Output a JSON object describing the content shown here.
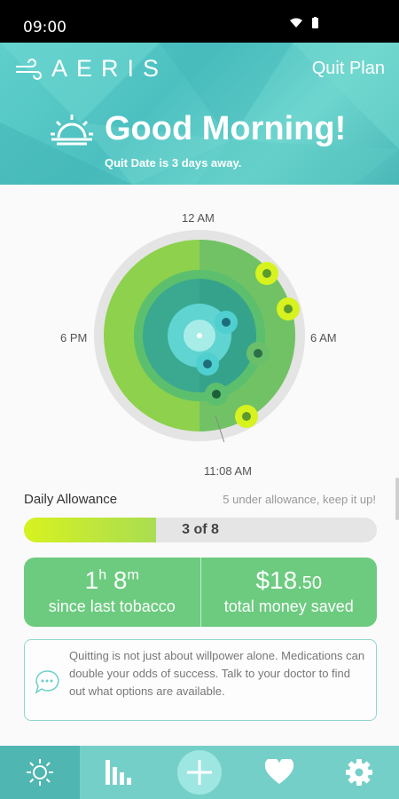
{
  "status_bar": {
    "time": "09:00"
  },
  "header": {
    "logo_text": "AERIS",
    "quit_plan_label": "Quit Plan",
    "greeting": "Good Morning!",
    "subtitle": "Quit Date is 3 days away."
  },
  "clock": {
    "top_label": "12 AM",
    "left_label": "6 PM",
    "right_label": "6 AM",
    "current_time": "11:08 AM",
    "colors": {
      "outer": "#8ed14c",
      "middle": "#5bbf6e",
      "inner": "#3aa98f",
      "core": "#5fd4d0"
    }
  },
  "allowance": {
    "title": "Daily Allowance",
    "message": "5 under allowance, keep it up!",
    "used": 3,
    "total": 8,
    "count_text": "3 of 8"
  },
  "stats": {
    "time_hours": "1",
    "time_h_unit": "h",
    "time_minutes": "8",
    "time_m_unit": "m",
    "time_label": "since last tobacco",
    "money_main": "$18",
    "money_cents": ".50",
    "money_label": "total money saved"
  },
  "tip": {
    "text": "Quitting is not just about willpower alone. Medications can double your odds of success. Talk to your doctor to find out what options are available."
  },
  "tabs": [
    {
      "name": "home",
      "icon": "sun-icon"
    },
    {
      "name": "stats",
      "icon": "bar-chart-icon"
    },
    {
      "name": "add",
      "icon": "plus-icon"
    },
    {
      "name": "health",
      "icon": "heart-icon"
    },
    {
      "name": "settings",
      "icon": "gear-icon"
    }
  ]
}
